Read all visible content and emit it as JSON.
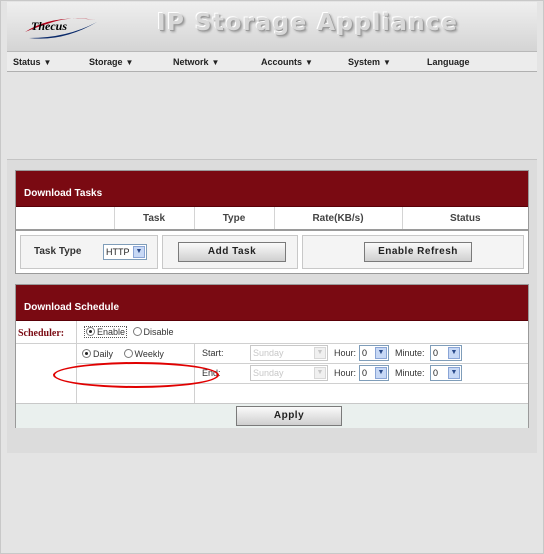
{
  "app": {
    "logo": "Thecus",
    "title": "IP Storage Appliance"
  },
  "nav": [
    {
      "label": "Status",
      "has_menu": true
    },
    {
      "label": "Storage",
      "has_menu": true
    },
    {
      "label": "Network",
      "has_menu": true
    },
    {
      "label": "Accounts",
      "has_menu": true
    },
    {
      "label": "System",
      "has_menu": true
    },
    {
      "label": "Language",
      "has_menu": false
    }
  ],
  "download_tasks": {
    "title": "Download Tasks",
    "columns": [
      "",
      "Task",
      "Type",
      "Rate(KB/s)",
      "Status"
    ]
  },
  "toolbar": {
    "task_type_label": "Task Type",
    "task_type_value": "HTTP",
    "add_task_label": "Add Task",
    "enable_refresh_label": "Enable Refresh"
  },
  "schedule": {
    "title": "Download Schedule",
    "scheduler_label": "Scheduler:",
    "enable_label": "Enable",
    "disable_label": "Disable",
    "scheduler_value": "Enable",
    "daily_label": "Daily",
    "weekly_label": "Weekly",
    "frequency_value": "Daily",
    "start_label": "Start:",
    "end_label": "End:",
    "start_day": "Sunday",
    "end_day": "Sunday",
    "hour_label": "Hour:",
    "minute_label": "Minute:",
    "start_hour": "0",
    "start_minute": "0",
    "end_hour": "0",
    "end_minute": "0",
    "apply_label": "Apply"
  },
  "colors": {
    "header_bar": "#7a0a12",
    "annotation": "#e00000"
  }
}
